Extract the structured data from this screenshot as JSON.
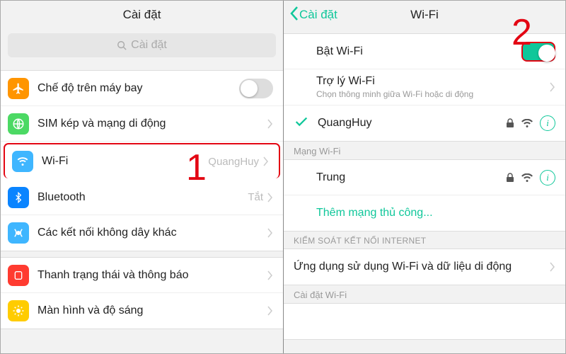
{
  "colors": {
    "accent": "#0fc79a",
    "highlight": "#e30613",
    "orange": "#ff9500",
    "green": "#4cd964",
    "blue": "#3fb6ff",
    "blue2": "#0a84ff",
    "red": "#ff3b30",
    "yellow": "#ffcc00"
  },
  "annotations": {
    "one": "1",
    "two": "2"
  },
  "left": {
    "title": "Cài đặt",
    "search_placeholder": "Cài đặt",
    "rows": {
      "airplane": "Chế độ trên máy bay",
      "sim": "SIM kép và mạng di động",
      "wifi": "Wi-Fi",
      "wifi_detail": "QuangHuy",
      "bluetooth": "Bluetooth",
      "bluetooth_detail": "Tắt",
      "other": "Các kết nối không dây khác",
      "status": "Thanh trạng thái và thông báo",
      "display": "Màn hình và độ sáng"
    }
  },
  "right": {
    "back": "Cài đặt",
    "title": "Wi-Fi",
    "enable": "Bật Wi-Fi",
    "assistant": "Trợ lý Wi-Fi",
    "assistant_sub": "Chọn thông minh giữa Wi-Fi hoặc di động",
    "connected": "QuangHuy",
    "section_networks": "Mạng Wi-Fi",
    "network1": "Trung",
    "add_manual": "Thêm mạng thủ công...",
    "section_control": "KIỂM SOÁT KẾT NỐI INTERNET",
    "apps_using": "Ứng dụng sử dụng Wi-Fi và dữ liệu di động",
    "section_settings": "Cài đặt Wi-Fi"
  }
}
